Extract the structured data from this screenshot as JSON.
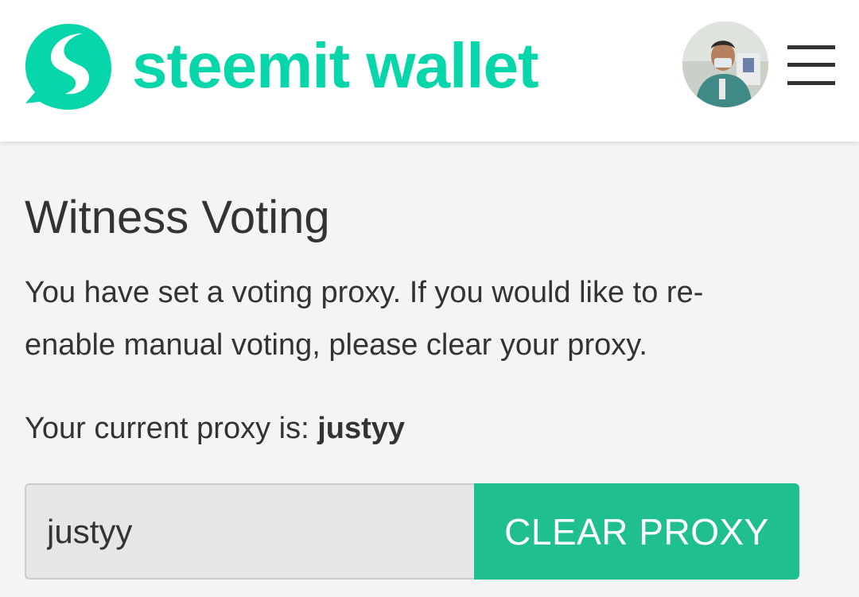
{
  "header": {
    "brand": "steemit wallet",
    "brand_color": "#06d6a9",
    "avatar_icon": "user-avatar",
    "menu_icon": "hamburger-menu-icon"
  },
  "main": {
    "title": "Witness Voting",
    "description": "You have set a voting proxy. If you would like to re-enable manual voting, please clear your proxy.",
    "proxy_label": "Your current proxy is: ",
    "proxy_name": "justyy",
    "proxy_input_value": "justyy",
    "clear_button_label": "CLEAR PROXY",
    "button_color": "#1fbf8f"
  }
}
